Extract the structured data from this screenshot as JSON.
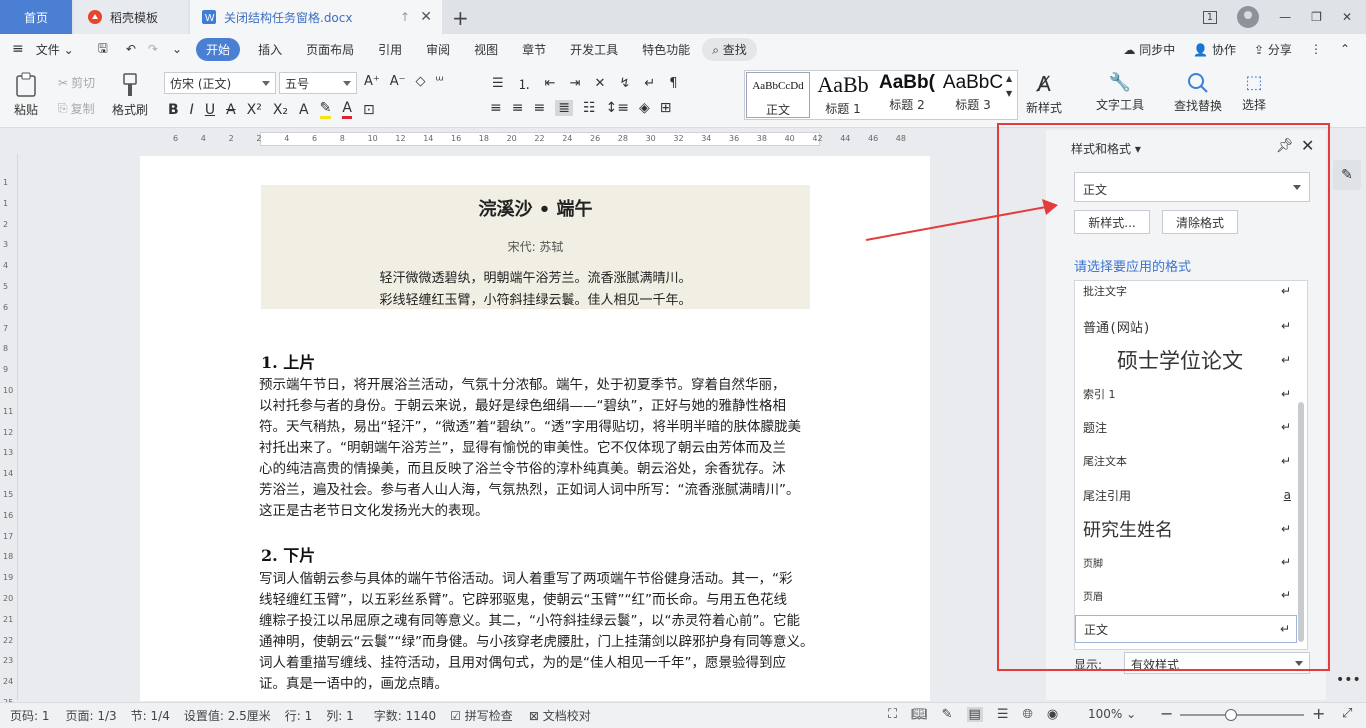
{
  "tabs": {
    "home": "首页",
    "template": "稻壳模板",
    "document": "关闭结构任务窗格.docx"
  },
  "window": {
    "page_count": "1"
  },
  "menu": {
    "file": "文件",
    "items": [
      "开始",
      "插入",
      "页面布局",
      "引用",
      "审阅",
      "视图",
      "章节",
      "开发工具",
      "特色功能"
    ],
    "search": "查找",
    "sync": "同步中",
    "collab": "协作",
    "share": "分享"
  },
  "ribbon": {
    "paste": "粘贴",
    "cut": "剪切",
    "copy": "复制",
    "format_painter": "格式刷",
    "font_name": "仿宋 (正文)",
    "font_size": "五号",
    "new_style": "新样式",
    "text_tools": "文字工具",
    "find_replace": "查找替换",
    "select": "选择",
    "styles": [
      {
        "preview": "AaBbCcDd",
        "label": "正文"
      },
      {
        "preview": "AaBb",
        "label": "标题 1"
      },
      {
        "preview": "AaBb(",
        "label": "标题 2"
      },
      {
        "preview": "AaBbC",
        "label": "标题 3"
      }
    ]
  },
  "ruler": {
    "h_ticks": [
      "6",
      "4",
      "2",
      "2",
      "4",
      "6",
      "8",
      "10",
      "12",
      "14",
      "16",
      "18",
      "20",
      "22",
      "24",
      "26",
      "28",
      "30",
      "32",
      "34",
      "36",
      "38",
      "40",
      "42",
      "44",
      "46",
      "48"
    ],
    "v_ticks": [
      "1",
      "1",
      "2",
      "3",
      "4",
      "5",
      "6",
      "7",
      "8",
      "9",
      "10",
      "11",
      "12",
      "13",
      "14",
      "15",
      "16",
      "17",
      "18",
      "19",
      "20",
      "21",
      "22",
      "23",
      "24",
      "25"
    ]
  },
  "document": {
    "poem_title": "浣溪沙 • 端午",
    "poem_author": "宋代: 苏轼",
    "poem_lines": [
      "轻汗微微透碧纨，明朝端午浴芳兰。流香涨腻满晴川。",
      "彩线轻缠红玉臂，小符斜挂绿云鬟。佳人相见一千年。"
    ],
    "section1_title": "1. 上片",
    "section1_lines": [
      "预示端午节日，将开展浴兰活动，气氛十分浓郁。端午，处于初夏季节。穿着自然华丽，",
      "以衬托参与者的身份。于朝云来说，最好是绿色细绢——“碧纨”，正好与她的雅静性格相",
      "符。天气稍热，易出“轻汗”，“微透”着“碧纨”。“透”字用得贴切，将半明半暗的肤体朦胧美",
      "衬托出来了。“明朝端午浴芳兰”，显得有愉悦的审美性。它不仅体现了朝云由芳体而及兰",
      "心的纯洁高贵的情操美，而且反映了浴兰令节俗的淳朴纯真美。朝云浴处，余香犹存。沐",
      "芳浴兰，遍及社会。参与者人山人海，气氛热烈，正如词人词中所写：“流香涨腻满晴川”。",
      "这正是古老节日文化发扬光大的表现。"
    ],
    "section2_title": "2. 下片",
    "section2_lines": [
      "写词人偕朝云参与具体的端午节俗活动。词人着重写了两项端午节俗健身活动。其一，“彩",
      "线轻缠红玉臂”，以五彩丝系臂”。它辟邪驱鬼，使朝云“玉臂”“红”而长命。与用五色花线",
      "缠粽子投江以吊屈原之魂有同等意义。其二，“小符斜挂绿云鬟”，以“赤灵符着心前”。它能",
      "通神明，使朝云“云鬟”“绿”而身健。与小孩穿老虎腰肚，门上挂蒲剑以辟邪护身有同等意义。",
      "词人着重描写缠线、挂符活动，且用对偶句式，为的是“佳人相见一千年”，愿景验得到应",
      "证。真是一语中的，画龙点睛。"
    ]
  },
  "pane": {
    "title": "样式和格式",
    "current_style": "正文",
    "new_style_btn": "新样式...",
    "clear_format_btn": "清除格式",
    "hint": "请选择要应用的格式",
    "styles": [
      {
        "name": "批注文字",
        "mark": "↵"
      },
      {
        "name": "普通(网站)",
        "mark": "↵"
      },
      {
        "name": "硕士学位论文",
        "mark": "↵"
      },
      {
        "name": "索引 1",
        "mark": "↵"
      },
      {
        "name": "题注",
        "mark": "↵"
      },
      {
        "name": "尾注文本",
        "mark": "↵"
      },
      {
        "name": "尾注引用",
        "mark": "a"
      },
      {
        "name": "研究生姓名",
        "mark": "↵"
      },
      {
        "name": "页脚",
        "mark": "↵"
      },
      {
        "name": "页眉",
        "mark": "↵"
      },
      {
        "name": "正文",
        "mark": "↵"
      }
    ],
    "show_label": "显示:",
    "show_value": "有效样式"
  },
  "status": {
    "page_num": "页码: 1",
    "page_total": "页面: 1/3",
    "section": "节: 1/4",
    "setting": "设置值: 2.5厘米",
    "row": "行: 1",
    "col": "列: 1",
    "words": "字数: 1140",
    "spell": "拼写检查",
    "proof": "文档校对",
    "zoom": "100%"
  },
  "colors": {
    "accent": "#4a7fd4",
    "annotation": "#e33c3c",
    "poem_bg": "#f1efe4"
  }
}
